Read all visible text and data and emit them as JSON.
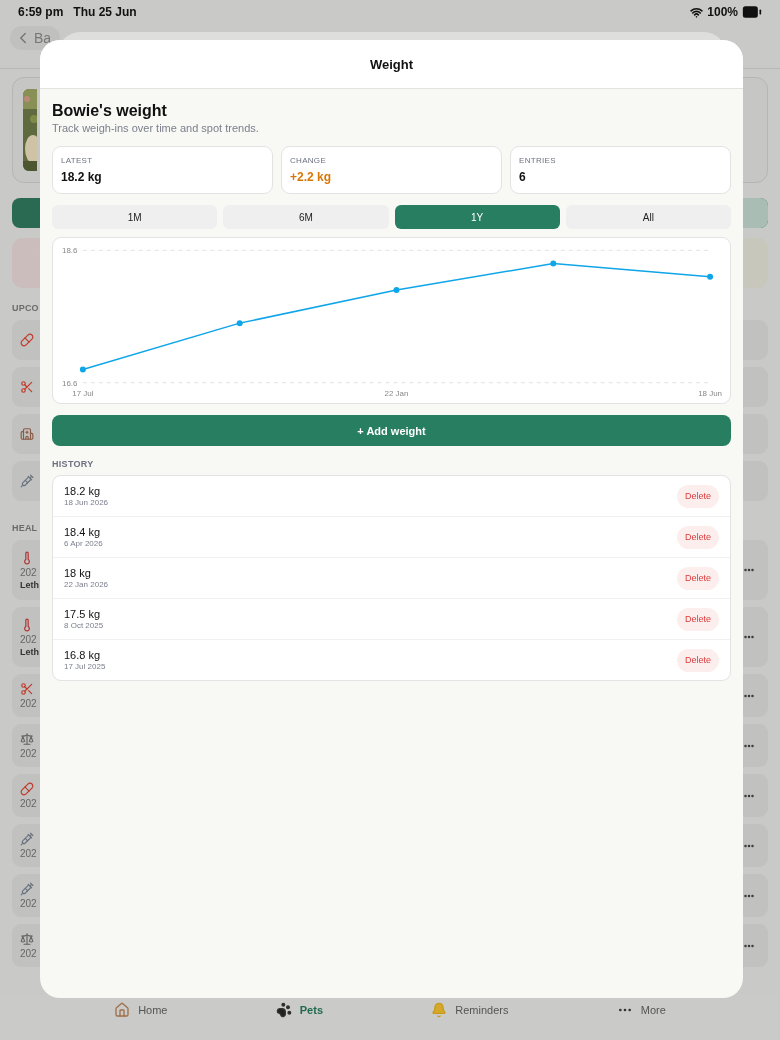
{
  "status_bar": {
    "time": "6:59 pm",
    "date": "Thu 25 Jun",
    "battery": "100%"
  },
  "background": {
    "back_label": "Ba",
    "sections": [
      {
        "label": "UPCO",
        "items": [
          {
            "kind": "pill",
            "menu": false
          },
          {
            "kind": "scissors",
            "menu": false
          },
          {
            "kind": "hospital",
            "menu": false
          },
          {
            "kind": "syringe",
            "menu": false
          }
        ]
      },
      {
        "label": "HEAL",
        "items": [
          {
            "kind": "thermometer",
            "lines": [
              "202",
              "Leth"
            ],
            "menu": true
          },
          {
            "kind": "thermometer",
            "lines": [
              "202",
              "Leth"
            ],
            "menu": true
          },
          {
            "kind": "scissors",
            "lines": [
              "202"
            ],
            "menu": true
          },
          {
            "kind": "scale",
            "lines": [
              "202"
            ],
            "menu": true
          },
          {
            "kind": "pill",
            "lines": [
              "202"
            ],
            "menu": true
          },
          {
            "kind": "syringe",
            "lines": [
              "202"
            ],
            "menu": true
          },
          {
            "kind": "syringe",
            "lines": [
              "202"
            ],
            "menu": true
          },
          {
            "kind": "scale",
            "lines": [
              "202"
            ],
            "menu": true
          }
        ]
      }
    ]
  },
  "sheet": {
    "title": "Weight",
    "heading": "Bowie's weight",
    "subtitle": "Track weigh-ins over time and spot trends.",
    "stats": [
      {
        "label": "LATEST",
        "value": "18.2 kg",
        "kind": "plain"
      },
      {
        "label": "CHANGE",
        "value": "+2.2 kg",
        "kind": "change"
      },
      {
        "label": "ENTRIES",
        "value": "6",
        "kind": "plain"
      }
    ],
    "ranges": [
      {
        "label": "1M",
        "selected": false
      },
      {
        "label": "6M",
        "selected": false
      },
      {
        "label": "1Y",
        "selected": true
      },
      {
        "label": "All",
        "selected": false
      }
    ],
    "chart_data": {
      "type": "line",
      "categories": [
        "17 Jul",
        null,
        "22 Jan",
        null,
        "18 Jun"
      ],
      "series": [
        {
          "color": "#0ea5e9",
          "marker": "circle",
          "values": [
            16.8,
            17.5,
            18,
            18.4,
            18.2
          ]
        }
      ],
      "ylim": [
        16.6,
        18.6
      ],
      "yticks": [
        18.6,
        16.6
      ]
    },
    "add_button": "+ Add weight",
    "history_label": "HISTORY",
    "history": [
      {
        "weight": "18.2 kg",
        "date": "18 Jun 2026",
        "action": "Delete"
      },
      {
        "weight": "18.4 kg",
        "date": "6 Apr 2026",
        "action": "Delete"
      },
      {
        "weight": "18 kg",
        "date": "22 Jan 2026",
        "action": "Delete"
      },
      {
        "weight": "17.5 kg",
        "date": "8 Oct 2025",
        "action": "Delete"
      },
      {
        "weight": "16.8 kg",
        "date": "17 Jul 2025",
        "action": "Delete"
      }
    ]
  },
  "tab_bar": [
    {
      "label": "Home",
      "kind": "home",
      "selected": false
    },
    {
      "label": "Pets",
      "kind": "paw",
      "selected": true
    },
    {
      "label": "Reminders",
      "kind": "bell",
      "selected": false
    },
    {
      "label": "More",
      "kind": "more",
      "selected": false
    }
  ]
}
